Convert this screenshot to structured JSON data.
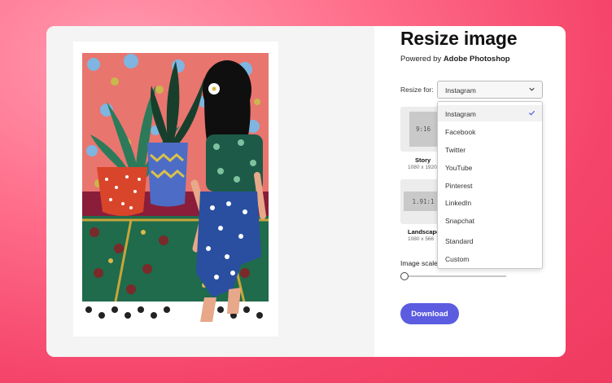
{
  "title": "Resize image",
  "powered_prefix": "Powered by",
  "powered_brand": "Adobe Photoshop",
  "resize_for_label": "Resize for:",
  "selected_platform": "Instagram",
  "platform_options": [
    "Instagram",
    "Facebook",
    "Twitter",
    "YouTube",
    "Pinterest",
    "LinkedIn",
    "Snapchat",
    "Standard",
    "Custom"
  ],
  "presets": [
    {
      "ratio": "9:16",
      "name": "Story",
      "size": "1080 x 1920"
    },
    {
      "ratio": "1.91:1",
      "name": "Landscape",
      "size": "1080 x 566"
    }
  ],
  "image_scale_label": "Image scale",
  "image_scale_value": 0,
  "download_label": "Download",
  "colors": {
    "accent": "#5b5ce0",
    "background": "#f5456a",
    "check": "#5b5ce0"
  },
  "icons": {
    "dropdown": "chevron-down-icon",
    "selected": "checkmark-icon"
  }
}
